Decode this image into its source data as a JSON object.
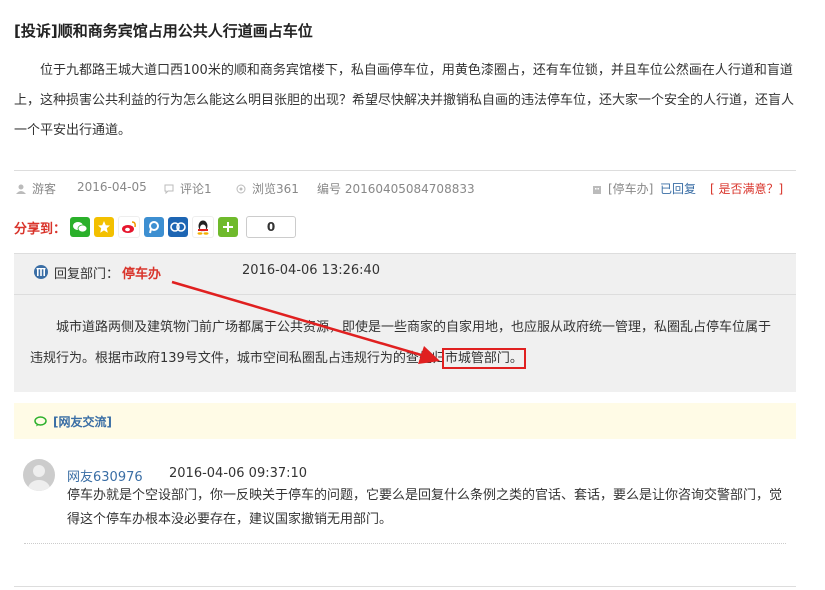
{
  "post": {
    "title": "[投诉]顺和商务宾馆占用公共人行道画占车位",
    "description": "位于九都路王城大道口西100米的顺和商务宾馆楼下，私自画停车位，用黄色漆圈占，还有车位锁，并且车位公然画在人行道和盲道上，这种损害公共利益的行为怎么能这么明目张胆的出现？希望尽快解决并撤销私自画的违法停车位，还大家一个安全的人行道，还盲人一个平安出行通道。"
  },
  "meta": {
    "author": "游客",
    "date": "2016-04-05",
    "comments": "评论1",
    "views": "浏览361",
    "number": "编号 20160405084708833",
    "dept_tag": "[停车办]",
    "status": "已回复",
    "satisfied": "[ 是否满意？]"
  },
  "share": {
    "label": "分享到：",
    "count": "0",
    "icons": [
      "wechat-icon",
      "qzone-icon",
      "weibo-icon",
      "tencent-weibo-icon",
      "renren-icon",
      "qq-icon",
      "more-share-icon"
    ]
  },
  "reply": {
    "dept_label": "回复部门：",
    "dept_name": "停车办",
    "datetime": "2016-04-06 13:26:40",
    "text_before": "城市道路两侧及建筑物门前广场都属于公共资源，即使是一些商家的自家用地，也应服从政府统一管理，私圈乱占停车位属于违规行为。根据市政府139号文件，城市空间私圈乱占违规行为的查处归",
    "text_highlight": "市城管部门。"
  },
  "netfriend": {
    "label": "[网友交流]"
  },
  "comments": [
    {
      "user": "网友630976",
      "datetime": "2016-04-06 09:37:10",
      "text": "停车办就是个空设部门，你一反映关于停车的问题，它要么是回复什么条例之类的官话、套话，要么是让你咨询交警部门，觉得这个停车办根本没必要存在，建议国家撤销无用部门。"
    }
  ],
  "colors": {
    "accent_red": "#e02020",
    "link_blue": "#3a6ea5",
    "dept_red": "#d9342b"
  }
}
